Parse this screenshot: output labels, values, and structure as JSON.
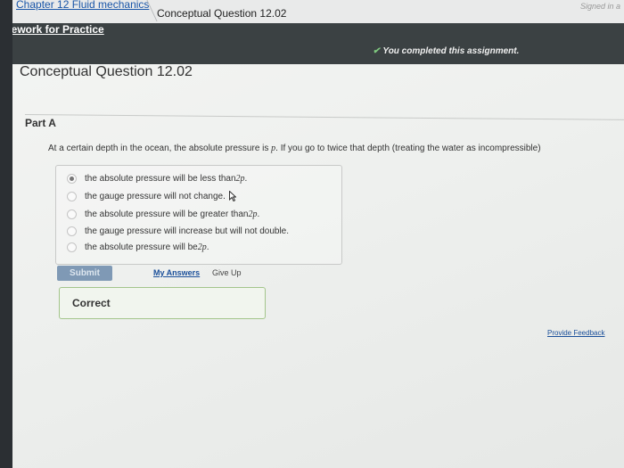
{
  "breadcrumb": {
    "chapter": "Chapter 12 Fluid mechanics",
    "current": "Conceptual Question 12.02"
  },
  "header": {
    "signed_in": "Signed in a",
    "rework": "Rework for Practice",
    "completed": "You completed this assignment."
  },
  "question": {
    "title": "Conceptual Question 12.02",
    "part": "Part A",
    "text_a": "At a certain depth in the ocean, the absolute pressure is ",
    "text_p": "p",
    "text_b": ". If you go to twice that depth (treating the water as incompressible)",
    "choices": [
      {
        "text": "the absolute pressure will be less than ",
        "math": "2p",
        "tail": ".",
        "selected": true
      },
      {
        "text": "the gauge pressure will not change.",
        "math": "",
        "tail": "",
        "selected": false
      },
      {
        "text": "the absolute pressure will be greater than ",
        "math": "2p",
        "tail": ".",
        "selected": false
      },
      {
        "text": "the gauge pressure will increase but will not double.",
        "math": "",
        "tail": "",
        "selected": false
      },
      {
        "text": "the absolute pressure will be ",
        "math": "2p",
        "tail": ".",
        "selected": false
      }
    ]
  },
  "actions": {
    "submit": "Submit",
    "my_answers": "My Answers",
    "give_up": "Give Up"
  },
  "result": {
    "label": "Correct"
  },
  "footer": {
    "feedback": "Provide Feedback"
  },
  "colors": {
    "header_bar": "#3b4143",
    "submit": "#7f99b5",
    "link": "#1a4f9a",
    "correct_border": "#a3c58b"
  }
}
